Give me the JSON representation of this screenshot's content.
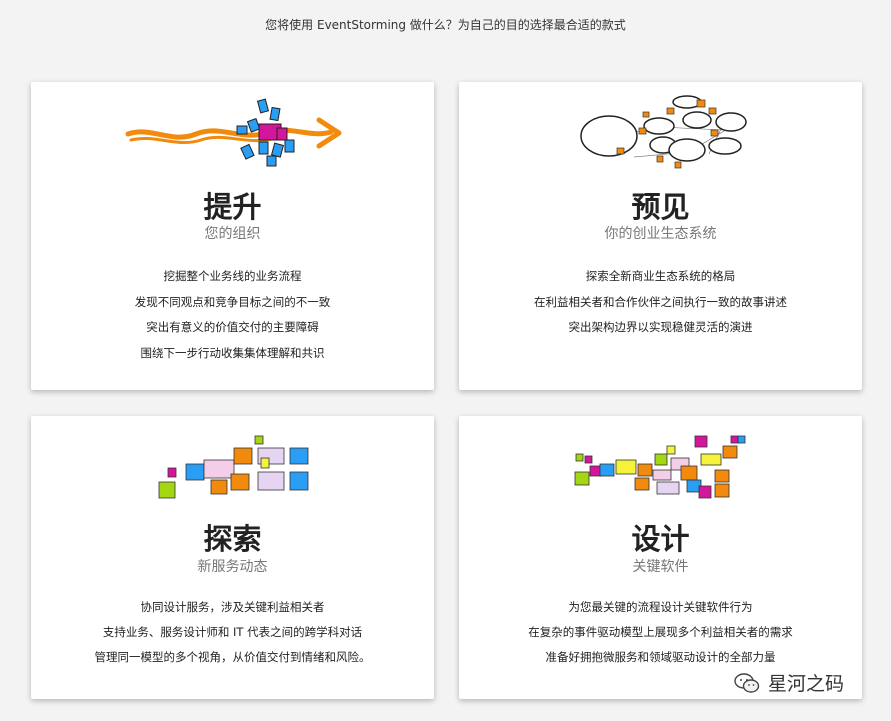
{
  "header": {
    "prompt": "您将使用 EventStorming 做什么？为自己的目的选择最合适的款式"
  },
  "cards": [
    {
      "title": "提升",
      "subtitle": "您的组织",
      "lines": [
        "挖掘整个业务线的业务流程",
        "发现不同观点和竞争目标之间的不一致",
        "突出有意义的价值交付的主要障碍",
        "围绕下一步行动收集集体理解和共识"
      ],
      "illustration": "arrow-with-sticky-notes-icon"
    },
    {
      "title": "预见",
      "subtitle": "你的创业生态系统",
      "lines": [
        "探索全新商业生态系统的格局",
        "在利益相关者和合作伙伴之间执行一致的故事讲述",
        "突出架构边界以实现稳健灵活的演进"
      ],
      "illustration": "ecosystem-bubbles-icon"
    },
    {
      "title": "探索",
      "subtitle": "新服务动态",
      "lines": [
        "协同设计服务，涉及关键利益相关者",
        "支持业务、服务设计师和 IT 代表之间的跨学科对话",
        "管理同一模型的多个视角，从价值交付到情绪和风险。"
      ],
      "illustration": "sticky-notes-cluster-icon"
    },
    {
      "title": "设计",
      "subtitle": "关键软件",
      "lines": [
        "为您最关键的流程设计关键软件行为",
        "在复杂的事件驱动模型上展现多个利益相关者的需求",
        "准备好拥抱微服务和领域驱动设计的全部力量"
      ],
      "illustration": "sticky-notes-flow-icon"
    }
  ],
  "watermark": {
    "text": "星河之码",
    "icon": "wechat-icon"
  },
  "colors": {
    "orange": "#f28a0e",
    "blue": "#2a9df4",
    "magenta": "#d4169c",
    "pink": "#f4cde8",
    "lime": "#a5d613",
    "yellow": "#f4f23a",
    "lavender": "#e5d5f2"
  }
}
